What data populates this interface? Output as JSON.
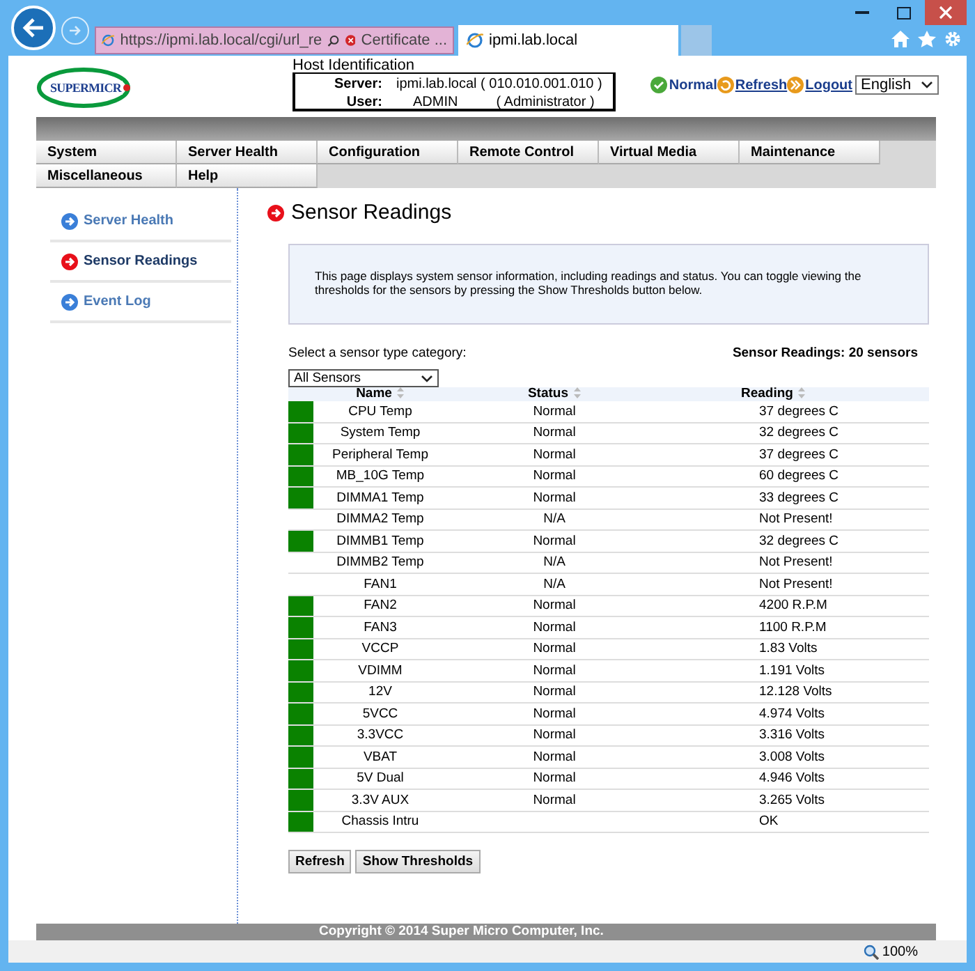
{
  "browser": {
    "address": "https://ipmi.lab.local/cgi/url_re",
    "certificate": "Certificate ...",
    "tabs": [
      {
        "label": "ipmi.lab.local",
        "selected": true
      }
    ]
  },
  "header": {
    "logo": "SUPERMICR",
    "host_title": "Host Identification",
    "server_label": "Server:",
    "server_value": "ipmi.lab.local  ( 010.010.001.010 )",
    "user_label": "User:",
    "user_value": "ADMIN",
    "user_role": "( Administrator )",
    "links": [
      {
        "label": "Normal",
        "kind": "status"
      },
      {
        "label": "Refresh",
        "kind": "refresh"
      },
      {
        "label": "Logout",
        "kind": "logout"
      }
    ],
    "language": "English"
  },
  "menu": [
    [
      {
        "label": "System"
      },
      {
        "label": "Server Health"
      },
      {
        "label": "Configuration"
      },
      {
        "label": "Remote Control"
      },
      {
        "label": "Virtual Media"
      },
      {
        "label": "Maintenance"
      }
    ],
    [
      {
        "label": "Miscellaneous"
      },
      {
        "label": "Help"
      }
    ]
  ],
  "sidebar": {
    "items": [
      {
        "label": "Server Health",
        "selected": false
      },
      {
        "label": "Sensor Readings",
        "selected": true
      },
      {
        "label": "Event Log",
        "selected": false
      }
    ]
  },
  "content": {
    "title": "Sensor Readings",
    "description": "This page displays system sensor information, including readings and status. You can toggle viewing the thresholds for the sensors by pressing the Show Thresholds button below.",
    "category_label": "Select a sensor type category:",
    "count": "Sensor Readings: 20 sensors",
    "category": "All Sensors",
    "columns": [
      "Name",
      "Status",
      "Reading"
    ],
    "rows": [
      {
        "name": "CPU Temp",
        "status": "Normal",
        "reading": "37 degrees C",
        "ok": true
      },
      {
        "name": "System Temp",
        "status": "Normal",
        "reading": "32 degrees C",
        "ok": true
      },
      {
        "name": "Peripheral Temp",
        "status": "Normal",
        "reading": "37 degrees C",
        "ok": true
      },
      {
        "name": "MB_10G Temp",
        "status": "Normal",
        "reading": "60 degrees C",
        "ok": true
      },
      {
        "name": "DIMMA1 Temp",
        "status": "Normal",
        "reading": "33 degrees C",
        "ok": true
      },
      {
        "name": "DIMMA2 Temp",
        "status": "N/A",
        "reading": "Not Present!",
        "ok": false
      },
      {
        "name": "DIMMB1 Temp",
        "status": "Normal",
        "reading": "32 degrees C",
        "ok": true
      },
      {
        "name": "DIMMB2 Temp",
        "status": "N/A",
        "reading": "Not Present!",
        "ok": false
      },
      {
        "name": "FAN1",
        "status": "N/A",
        "reading": "Not Present!",
        "ok": false
      },
      {
        "name": "FAN2",
        "status": "Normal",
        "reading": "4200 R.P.M",
        "ok": true
      },
      {
        "name": "FAN3",
        "status": "Normal",
        "reading": "1100 R.P.M",
        "ok": true
      },
      {
        "name": "VCCP",
        "status": "Normal",
        "reading": "1.83 Volts",
        "ok": true
      },
      {
        "name": "VDIMM",
        "status": "Normal",
        "reading": "1.191 Volts",
        "ok": true
      },
      {
        "name": "12V",
        "status": "Normal",
        "reading": "12.128 Volts",
        "ok": true
      },
      {
        "name": "5VCC",
        "status": "Normal",
        "reading": "4.974 Volts",
        "ok": true
      },
      {
        "name": "3.3VCC",
        "status": "Normal",
        "reading": "3.316 Volts",
        "ok": true
      },
      {
        "name": "VBAT",
        "status": "Normal",
        "reading": "3.008 Volts",
        "ok": true
      },
      {
        "name": "5V Dual",
        "status": "Normal",
        "reading": "4.946 Volts",
        "ok": true
      },
      {
        "name": "3.3V AUX",
        "status": "Normal",
        "reading": "3.265 Volts",
        "ok": true
      },
      {
        "name": "Chassis Intru",
        "reading": "OK",
        "ok": true
      }
    ],
    "buttons": [
      "Refresh",
      "Show Thresholds"
    ]
  },
  "footer": "Copyright © 2014 Super Micro Computer, Inc.",
  "status_bar": {
    "zoom": "100%"
  }
}
